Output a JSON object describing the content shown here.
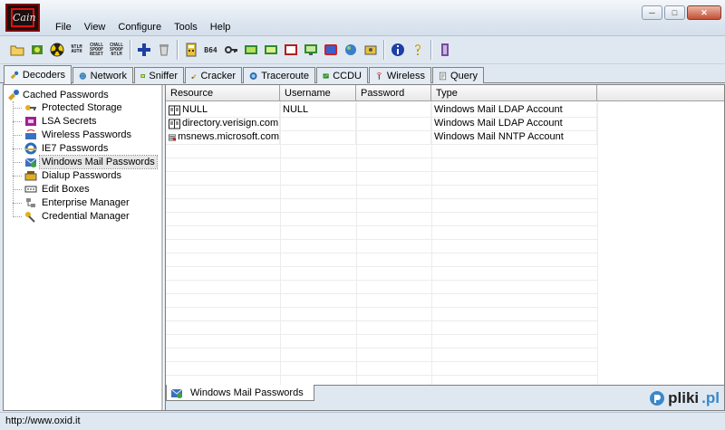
{
  "app": {
    "logo_text": "Cain"
  },
  "menu": [
    "File",
    "View",
    "Configure",
    "Tools",
    "Help"
  ],
  "window_buttons": {
    "minimize": "─",
    "maximize": "□",
    "close": "✕"
  },
  "toolbar": {
    "text_buttons": [
      "NTLM AUTH",
      "CHALL SPOOF RESET",
      "CHALL SPOOF NTLM"
    ],
    "b64_label": "B64"
  },
  "tabs": [
    {
      "label": "Decoders",
      "icon": "decoder-icon",
      "active": true
    },
    {
      "label": "Network",
      "icon": "network-icon"
    },
    {
      "label": "Sniffer",
      "icon": "sniffer-icon"
    },
    {
      "label": "Cracker",
      "icon": "cracker-icon"
    },
    {
      "label": "Traceroute",
      "icon": "traceroute-icon"
    },
    {
      "label": "CCDU",
      "icon": "ccdu-icon"
    },
    {
      "label": "Wireless",
      "icon": "wireless-icon"
    },
    {
      "label": "Query",
      "icon": "query-icon"
    }
  ],
  "tree": {
    "root": "Cached Passwords",
    "items": [
      {
        "label": "Protected Storage",
        "icon": "key-icon"
      },
      {
        "label": "LSA Secrets",
        "icon": "lsa-icon"
      },
      {
        "label": "Wireless Passwords",
        "icon": "wireless-icon"
      },
      {
        "label": "IE7 Passwords",
        "icon": "ie-icon"
      },
      {
        "label": "Windows Mail Passwords",
        "icon": "mail-icon",
        "selected": true
      },
      {
        "label": "Dialup Passwords",
        "icon": "dialup-icon"
      },
      {
        "label": "Edit Boxes",
        "icon": "editbox-icon"
      },
      {
        "label": "Enterprise Manager",
        "icon": "enterprise-icon"
      },
      {
        "label": "Credential Manager",
        "icon": "credential-icon"
      }
    ]
  },
  "list": {
    "columns": [
      "Resource",
      "Username",
      "Password",
      "Type"
    ],
    "rows": [
      {
        "resource": "NULL",
        "username": "NULL",
        "password": "",
        "type": "Windows Mail LDAP Account",
        "icon": "ldap-icon"
      },
      {
        "resource": "directory.verisign.com",
        "username": "",
        "password": "",
        "type": "Windows Mail LDAP Account",
        "icon": "ldap-icon"
      },
      {
        "resource": "msnews.microsoft.com",
        "username": "",
        "password": "",
        "type": "Windows Mail NNTP Account",
        "icon": "nntp-icon"
      }
    ]
  },
  "subtab": {
    "label": "Windows Mail Passwords"
  },
  "status": {
    "text": "http://www.oxid.it"
  },
  "watermark": {
    "brand": "pliki",
    "tld": ".pl"
  }
}
